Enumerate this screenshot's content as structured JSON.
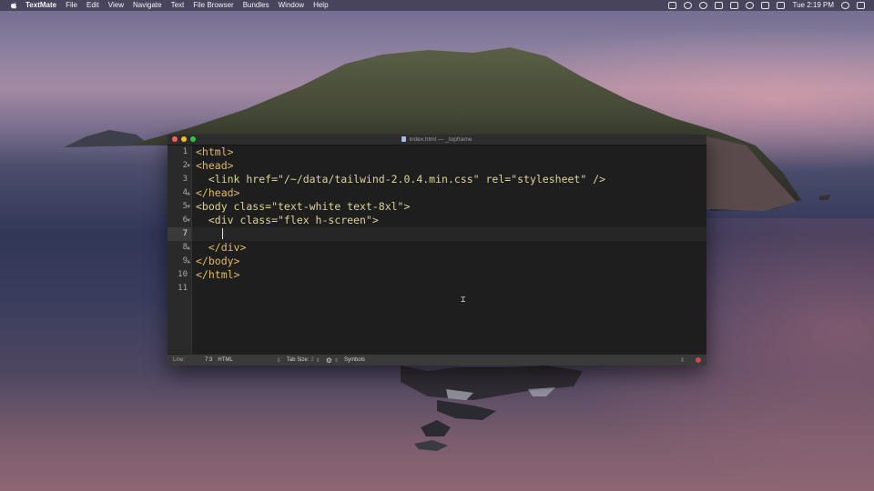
{
  "menubar": {
    "app_name": "TextMate",
    "items": [
      "File",
      "Edit",
      "View",
      "Navigate",
      "Text",
      "File Browser",
      "Bundles",
      "Window",
      "Help"
    ],
    "clock": "Tue 2:19 PM"
  },
  "window": {
    "title": "index.html — _topframe",
    "lights": {
      "close": "#ff5f57",
      "minimize": "#febc2e",
      "zoom": "#28c840"
    }
  },
  "editor": {
    "line_numbers": [
      "1",
      "2",
      "3",
      "4",
      "5",
      "6",
      "7",
      "8",
      "9",
      "10",
      "11"
    ],
    "active_line": 7,
    "lines": [
      "<html>",
      "<head>",
      "  <link href=\"/~/data/tailwind-2.0.4.min.css\" rel=\"stylesheet\" />",
      "</head>",
      "<body class=\"text-white text-8xl\">",
      "  <div class=\"flex h-screen\">",
      "    ",
      "  </div>",
      "</body>",
      "</html>",
      ""
    ]
  },
  "statusbar": {
    "line_label": "Line:",
    "position": "7:3",
    "language": "HTML",
    "tab_size_label": "Tab Size:",
    "tab_size": "2",
    "symbols": "Symbols"
  }
}
